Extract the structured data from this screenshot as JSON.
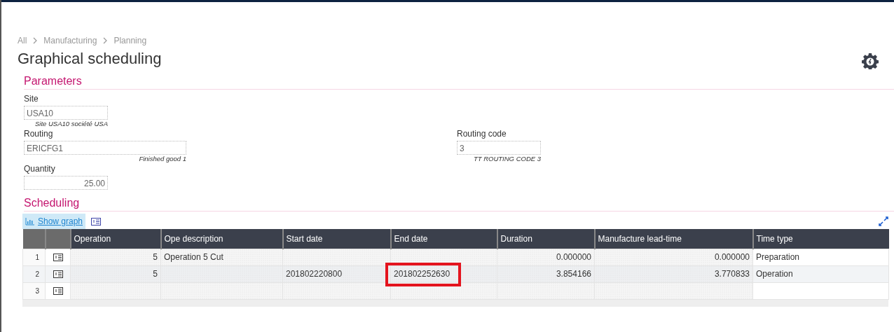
{
  "breadcrumb": [
    "All",
    "Manufacturing",
    "Planning"
  ],
  "title": "Graphical scheduling",
  "parameters": {
    "heading": "Parameters",
    "fields": [
      {
        "label": "Site",
        "value": "USA10",
        "hint": "Site USA10 société USA"
      },
      {
        "label": "Routing",
        "value": "ERICFG1",
        "hint": "Finished good 1"
      },
      {
        "label": "Routing code",
        "value": "3",
        "hint": "TT ROUTING CODE 3"
      },
      {
        "label": "Quantity",
        "value": "25.00"
      }
    ]
  },
  "scheduling": {
    "heading": "Scheduling",
    "show_graph": "Show graph",
    "columns": [
      "Operation",
      "Ope description",
      "Start date",
      "End date",
      "Duration",
      "Manufacture lead-time",
      "Time type"
    ],
    "rows": [
      {
        "number": "1",
        "selected": false,
        "cells": [
          "5",
          "Operation 5 Cut",
          "",
          "",
          "0.000000",
          "0.000000",
          "Preparation"
        ],
        "end_date_highlighted": false
      },
      {
        "number": "2",
        "selected": true,
        "cells": [
          "5",
          "",
          "201802220800",
          "201802252630",
          "3.854166",
          "3.770833",
          "Operation"
        ],
        "end_date_highlighted": true
      },
      {
        "number": "3",
        "selected": false,
        "cells": [
          "",
          "",
          "",
          "",
          "",
          "",
          ""
        ],
        "end_date_highlighted": false
      }
    ]
  }
}
